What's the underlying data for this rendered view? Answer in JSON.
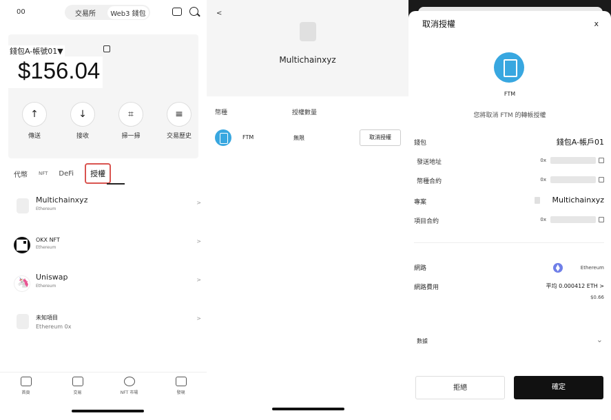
{
  "screen1": {
    "top_left": "00",
    "segment": [
      "交易所",
      "Web3 錢包"
    ],
    "wallet_name": "錢包A-帳號01▼",
    "balance": "$156.04",
    "actions": [
      {
        "label": "傳送",
        "icon": "↑"
      },
      {
        "label": "接收",
        "icon": "↓"
      },
      {
        "label": "掃一掃",
        "icon": "⌗"
      },
      {
        "label": "交易歷史",
        "icon": "≡"
      }
    ],
    "tabs": [
      "代幣",
      "NFT",
      "DeFi",
      "授權"
    ],
    "list": [
      {
        "name": "Multichainxyz",
        "chain": "Ethereum"
      },
      {
        "name": "OKX NFT",
        "chain": "Ethereum"
      },
      {
        "name": "Uniswap",
        "chain": "Ethereum"
      },
      {
        "name": "未知項目",
        "chain": "Ethereum 0x"
      }
    ],
    "bottom_nav": [
      "首頁",
      "交易",
      "NFT 市場",
      "發現"
    ]
  },
  "screen2": {
    "back": "<",
    "title": "Multichainxyz",
    "col_token": "幣種",
    "col_amount": "授權數量",
    "row": {
      "token": "FTM",
      "amount": "無限",
      "action": "取消授權"
    }
  },
  "screen3": {
    "title": "取消授權",
    "close": "x",
    "token": "FTM",
    "desc": "您將取消 FTM 的轉帳授權",
    "wallet_k": "錢包",
    "wallet_v": "錢包A-帳戶01",
    "sender_k": "發送地址",
    "sender_v": "0x",
    "contract_k": "幣種合約",
    "contract_v": "0x",
    "project_k": "專案",
    "project_v": "Multichainxyz",
    "proj_contract_k": "項目合約",
    "proj_contract_v": "0x",
    "network_k": "網路",
    "network_v": "Ethereum",
    "fee_k": "網路費用",
    "fee_v": "平均 0.000412 ETH >",
    "fee_usd": "$0.66",
    "data_k": "數據",
    "reject": "拒絕",
    "confirm": "確定"
  },
  "colors": {
    "ftm": "#38a7e0",
    "highlight": "#d9534f",
    "eth": "#6f7fe8"
  }
}
